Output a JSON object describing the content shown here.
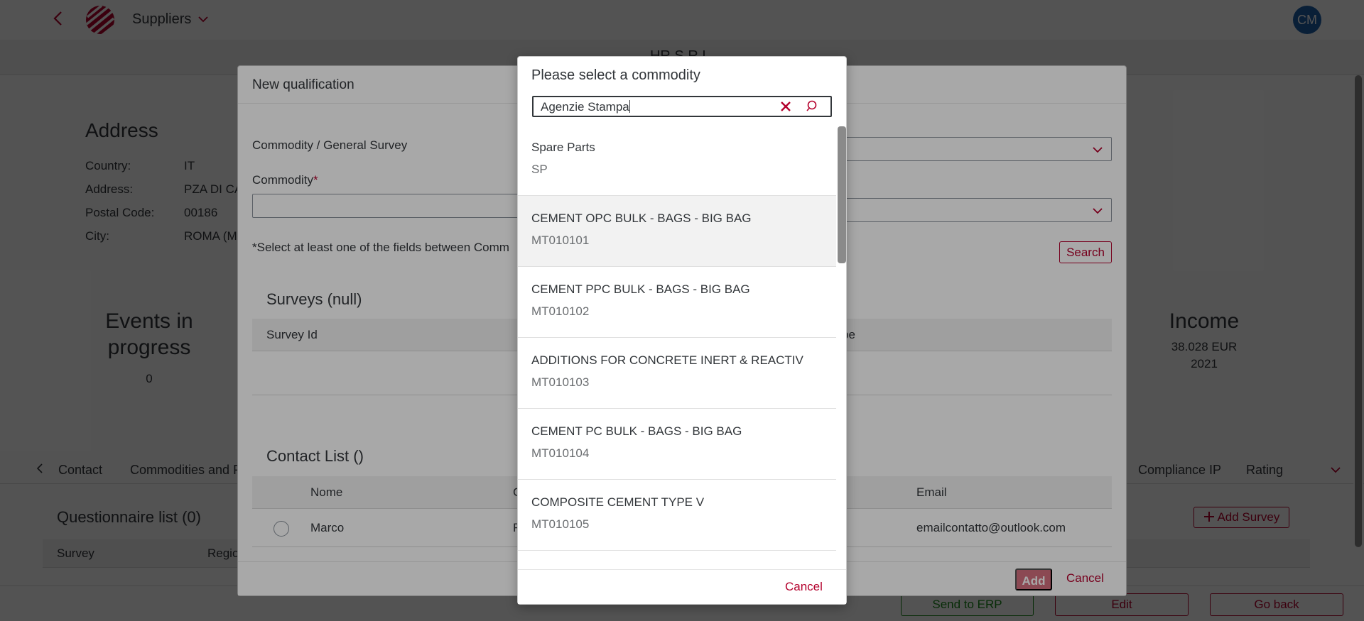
{
  "header": {
    "app_title": "Suppliers",
    "avatar_initials": "CM",
    "supplier_name": "HR S.R.L."
  },
  "address": {
    "title": "Address",
    "rows": [
      {
        "label": "Country:",
        "value": "IT"
      },
      {
        "label": "Address:",
        "value": "PZA DI CA"
      },
      {
        "label": "Postal Code:",
        "value": "00186"
      },
      {
        "label": "City:",
        "value": "ROMA (M"
      }
    ]
  },
  "kpis": {
    "events_title": "Events in progress",
    "events_value": "0",
    "income_title": "Income",
    "income_value": "38.028 EUR",
    "income_year": "2021"
  },
  "tabs": [
    "Contact",
    "Commodities and P",
    "Compliance IP",
    "Rating"
  ],
  "questionnaire": {
    "title": "Questionnaire list (0)",
    "columns": [
      "Survey",
      "Regio"
    ],
    "add_survey_label": "Add Survey"
  },
  "footer": {
    "send_erp": "Send to ERP",
    "edit": "Edit",
    "go_back": "Go back"
  },
  "qualification_dialog": {
    "title": "New qualification",
    "general_survey_label": "Commodity / General Survey",
    "commodity_label": "Commodity",
    "required_mark": "*",
    "hint": "*Select at least one of the fields between Comm",
    "search_label": "Search",
    "surveys_title": "Surveys (null)",
    "surveys_columns": [
      "Survey Id",
      "pe"
    ],
    "contact_title": "Contact List ()",
    "contact_columns": [
      "Nome",
      "C",
      "Email"
    ],
    "contact_rows": [
      {
        "nome": "Marco",
        "c": "F",
        "email": "emailcontatto@outlook.com"
      }
    ],
    "add_label": "Add",
    "cancel_label": "Cancel"
  },
  "commodity_dialog": {
    "title": "Please select a commodity",
    "search_value": "Agenzie Stampa",
    "items": [
      {
        "name": "Spare Parts",
        "code": "SP"
      },
      {
        "name": "CEMENT OPC BULK - BAGS - BIG BAG",
        "code": "MT010101"
      },
      {
        "name": "CEMENT PPC BULK - BAGS - BIG BAG",
        "code": "MT010102"
      },
      {
        "name": "ADDITIONS FOR CONCRETE INERT &  REACTIV",
        "code": "MT010103"
      },
      {
        "name": "CEMENT PC BULK - BAGS - BIG BAG",
        "code": "MT010104"
      },
      {
        "name": "COMPOSITE CEMENT TYPE V",
        "code": "MT010105"
      }
    ],
    "cancel_label": "Cancel"
  },
  "colors": {
    "accent": "#b4002c",
    "avatar": "#1f5ea8",
    "success": "#188918"
  }
}
